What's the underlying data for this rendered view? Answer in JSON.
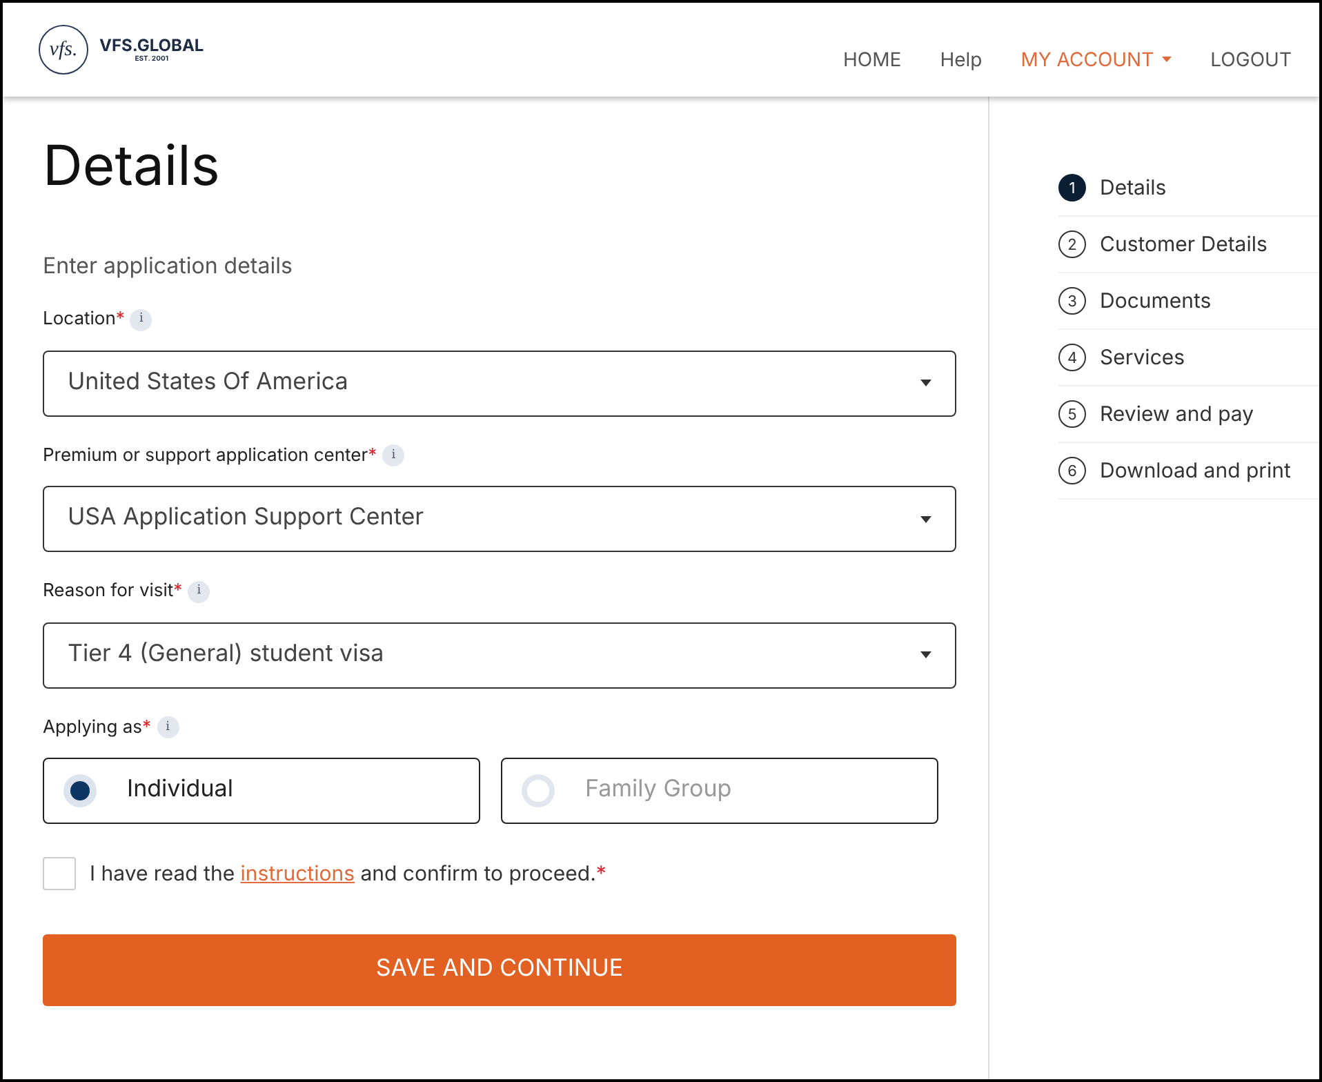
{
  "header": {
    "logo_mark": "vfs.",
    "logo_name": "VFS.GLOBAL",
    "logo_est": "EST. 2001",
    "nav": [
      {
        "label": "HOME",
        "selected": false,
        "dropdown": false
      },
      {
        "label": "Help",
        "selected": false,
        "dropdown": false
      },
      {
        "label": "MY ACCOUNT",
        "selected": true,
        "dropdown": true
      },
      {
        "label": "LOGOUT",
        "selected": false,
        "dropdown": false
      }
    ]
  },
  "form": {
    "title": "Details",
    "subtitle": "Enter application details",
    "selects": [
      {
        "label": "Location",
        "required_mark": "*",
        "info": "i",
        "value": "United States Of America"
      },
      {
        "label": "Premium or support application center",
        "required_mark": "*",
        "info": "i",
        "value": "USA Application Support Center"
      },
      {
        "label": "Reason for visit",
        "required_mark": "*",
        "info": "i",
        "value": "Tier 4 (General) student visa"
      }
    ],
    "applying_as": {
      "label": "Applying as",
      "required_mark": "*",
      "info": "i",
      "options": [
        {
          "label": "Individual",
          "selected": true
        },
        {
          "label": "Family Group",
          "selected": false
        }
      ]
    },
    "confirm": {
      "checked": false,
      "before": "I have read the ",
      "link": "instructions",
      "after": " and confirm to proceed.",
      "required_mark": "*"
    },
    "submit": "SAVE AND CONTINUE"
  },
  "steps": [
    {
      "number": "1",
      "label": "Details",
      "selected": true
    },
    {
      "number": "2",
      "label": "Customer Details",
      "selected": false
    },
    {
      "number": "3",
      "label": "Documents",
      "selected": false
    },
    {
      "number": "4",
      "label": "Services",
      "selected": false
    },
    {
      "number": "5",
      "label": "Review and pay",
      "selected": false
    },
    {
      "number": "6",
      "label": "Download and print",
      "selected": false
    }
  ]
}
